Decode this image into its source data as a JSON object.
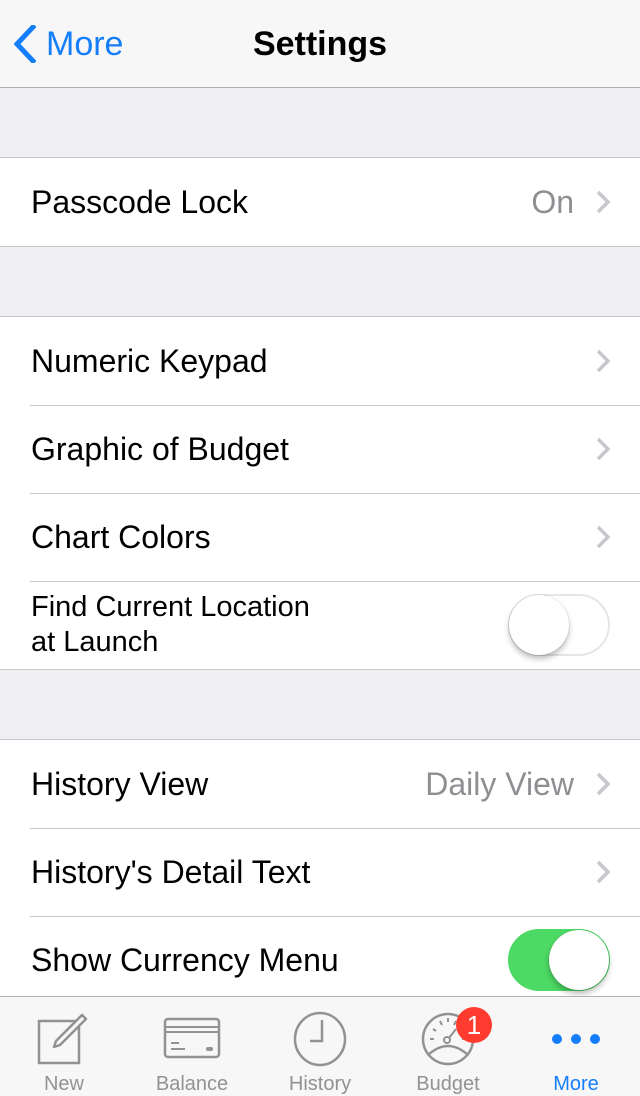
{
  "navbar": {
    "back_label": "More",
    "title": "Settings"
  },
  "sections": [
    {
      "rows": [
        {
          "label": "Passcode Lock",
          "detail": "On",
          "accessory": "chevron"
        }
      ]
    },
    {
      "rows": [
        {
          "label": "Numeric Keypad",
          "accessory": "chevron"
        },
        {
          "label": "Graphic of Budget",
          "accessory": "chevron"
        },
        {
          "label": "Chart Colors",
          "accessory": "chevron"
        },
        {
          "label_line1": "Find Current Location",
          "label_line2": "at Launch",
          "accessory": "toggle",
          "toggle_on": false
        }
      ]
    },
    {
      "rows": [
        {
          "label": "History View",
          "detail": "Daily View",
          "accessory": "chevron"
        },
        {
          "label": "History's Detail Text",
          "accessory": "chevron"
        },
        {
          "label": "Show Currency Menu",
          "accessory": "toggle",
          "toggle_on": true
        }
      ]
    }
  ],
  "tabbar": {
    "tabs": [
      {
        "label": "New",
        "icon": "compose-icon",
        "active": false
      },
      {
        "label": "Balance",
        "icon": "card-icon",
        "active": false
      },
      {
        "label": "History",
        "icon": "clock-icon",
        "active": false
      },
      {
        "label": "Budget",
        "icon": "gauge-icon",
        "active": false,
        "badge": "1"
      },
      {
        "label": "More",
        "icon": "more-dots-icon",
        "active": true
      }
    ]
  },
  "colors": {
    "accent": "#157efb",
    "toggle_on": "#4cd964",
    "badge": "#ff3b30",
    "background": "#efeff4"
  }
}
